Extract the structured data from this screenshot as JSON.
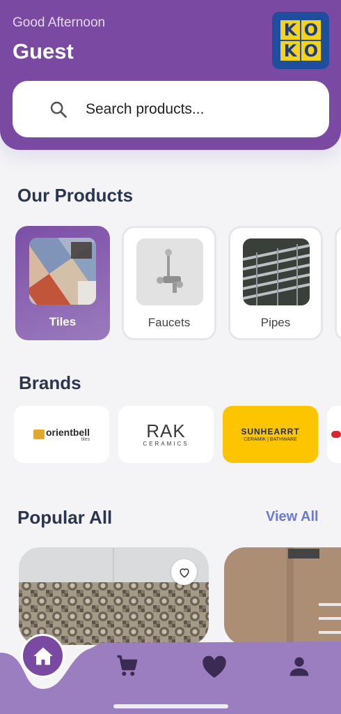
{
  "header": {
    "greeting": "Good Afternoon",
    "user_name": "Guest",
    "logo_letters": [
      "K",
      "O",
      "K",
      "O"
    ]
  },
  "search": {
    "placeholder": "Search products...",
    "icon": "search-icon"
  },
  "products": {
    "title": "Our Products",
    "items": [
      {
        "label": "Tiles",
        "active": true
      },
      {
        "label": "Faucets",
        "active": false
      },
      {
        "label": "Pipes",
        "active": false
      }
    ]
  },
  "brands": {
    "title": "Brands",
    "items": [
      {
        "name": "orientbell",
        "sub": "tiles"
      },
      {
        "name": "RAK",
        "sub": "CERAMICS"
      },
      {
        "name": "SUNHEARRT",
        "sub": "CERAMIK | BATHWARE"
      }
    ]
  },
  "popular": {
    "title": "Popular All",
    "view_all": "View All"
  },
  "nav": {
    "items": [
      "home-icon",
      "cart-icon",
      "heart-icon",
      "person-icon"
    ]
  },
  "colors": {
    "primary": "#7a4aa3",
    "accent": "#6a78d6",
    "logo_bg": "#1f4e9c",
    "logo_tile": "#f7d21a",
    "sunhearrt_bg": "#fdc500"
  }
}
